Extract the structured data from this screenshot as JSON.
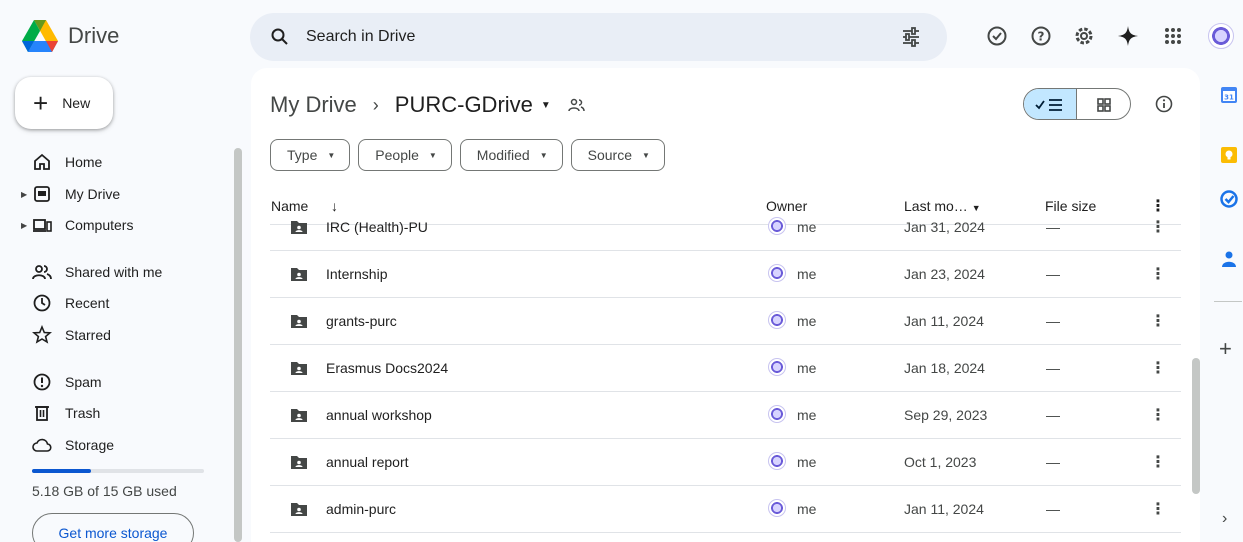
{
  "app": {
    "name": "Drive"
  },
  "search": {
    "placeholder": "Search in Drive"
  },
  "header_icons": [
    "search-filter-icon",
    "ready-offline-icon",
    "help-icon",
    "settings-icon",
    "gemini-icon",
    "apps-grid-icon",
    "account-avatar"
  ],
  "sidebar": {
    "new_label": "New",
    "items": [
      {
        "label": "Home",
        "icon": "home-icon"
      },
      {
        "label": "My Drive",
        "icon": "my-drive-icon"
      },
      {
        "label": "Computers",
        "icon": "computers-icon"
      },
      {
        "label": "Shared with me",
        "icon": "shared-icon"
      },
      {
        "label": "Recent",
        "icon": "clock-icon"
      },
      {
        "label": "Starred",
        "icon": "star-icon"
      },
      {
        "label": "Spam",
        "icon": "spam-icon"
      },
      {
        "label": "Trash",
        "icon": "trash-icon"
      },
      {
        "label": "Storage",
        "icon": "cloud-icon"
      }
    ],
    "storage": {
      "used_text": "5.18 GB of 15 GB used",
      "fraction": 0.345,
      "button_label": "Get more storage"
    }
  },
  "breadcrumb": {
    "root": "My Drive",
    "separator": "›",
    "current": "PURC-GDrive"
  },
  "filters": [
    "Type",
    "People",
    "Modified",
    "Source"
  ],
  "table": {
    "columns": {
      "name": "Name",
      "sort_arrow": "↓",
      "owner": "Owner",
      "modified": "Last mo…",
      "size": "File size"
    },
    "rows": [
      {
        "name": "IRC (Health)-PU",
        "owner": "me",
        "modified": "Jan 31, 2024",
        "size": "—"
      },
      {
        "name": "Internship",
        "owner": "me",
        "modified": "Jan 23, 2024",
        "size": "—"
      },
      {
        "name": "grants-purc",
        "owner": "me",
        "modified": "Jan 11, 2024",
        "size": "—"
      },
      {
        "name": "Erasmus Docs2024",
        "owner": "me",
        "modified": "Jan 18, 2024",
        "size": "—"
      },
      {
        "name": "annual workshop",
        "owner": "me",
        "modified": "Sep 29, 2023",
        "size": "—"
      },
      {
        "name": "annual report",
        "owner": "me",
        "modified": "Oct 1, 2023",
        "size": "—"
      },
      {
        "name": "admin-purc",
        "owner": "me",
        "modified": "Jan 11, 2024",
        "size": "—"
      }
    ]
  },
  "right_rail": [
    "calendar-icon",
    "keep-icon",
    "tasks-icon",
    "contacts-icon"
  ],
  "colors": {
    "accent": "#0b57d0",
    "selected": "#c2e7ff",
    "background": "#f8fafd"
  }
}
